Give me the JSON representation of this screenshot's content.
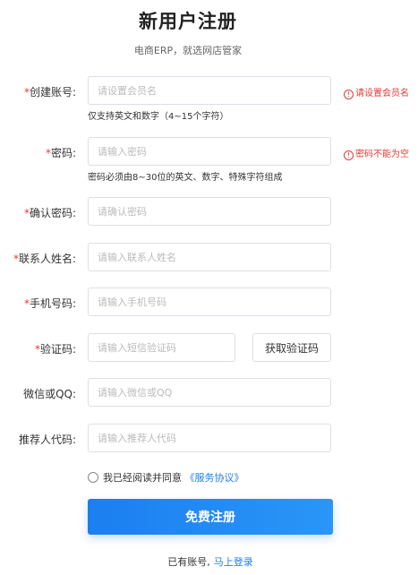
{
  "header": {
    "title": "新用户注册",
    "subtitle": "电商ERP，就选网店管家"
  },
  "colors": {
    "accent": "#1e7ee8",
    "error": "#e53935"
  },
  "form": {
    "account": {
      "required_mark": "*",
      "label": "创建账号:",
      "placeholder": "请设置会员名",
      "hint": "仅支持英文和数字（4~15个字符）",
      "error": "请设置会员名"
    },
    "password": {
      "required_mark": "*",
      "label": "密码:",
      "placeholder": "请输入密码",
      "hint": "密码必须由8~30位的英文、数字、特殊字符组成",
      "error": "密码不能为空"
    },
    "confirm": {
      "required_mark": "*",
      "label": "确认密码:",
      "placeholder": "请确认密码"
    },
    "contact": {
      "required_mark": "*",
      "label": "联系人姓名:",
      "placeholder": "请输入联系人姓名"
    },
    "phone": {
      "required_mark": "*",
      "label": "手机号码:",
      "placeholder": "请输入手机号码"
    },
    "code": {
      "required_mark": "*",
      "label": "验证码:",
      "placeholder": "请输入短信验证码",
      "button": "获取验证码"
    },
    "wechat": {
      "label": "微信或QQ:",
      "placeholder": "请输入微信或QQ"
    },
    "referrer": {
      "label": "推荐人代码:",
      "placeholder": "请输入推荐人代码"
    }
  },
  "agreement": {
    "text": "我已经阅读并同意",
    "link": "《服务协议》"
  },
  "submit_label": "免费注册",
  "footer": {
    "text": "已有账号,",
    "link": "马上登录"
  }
}
